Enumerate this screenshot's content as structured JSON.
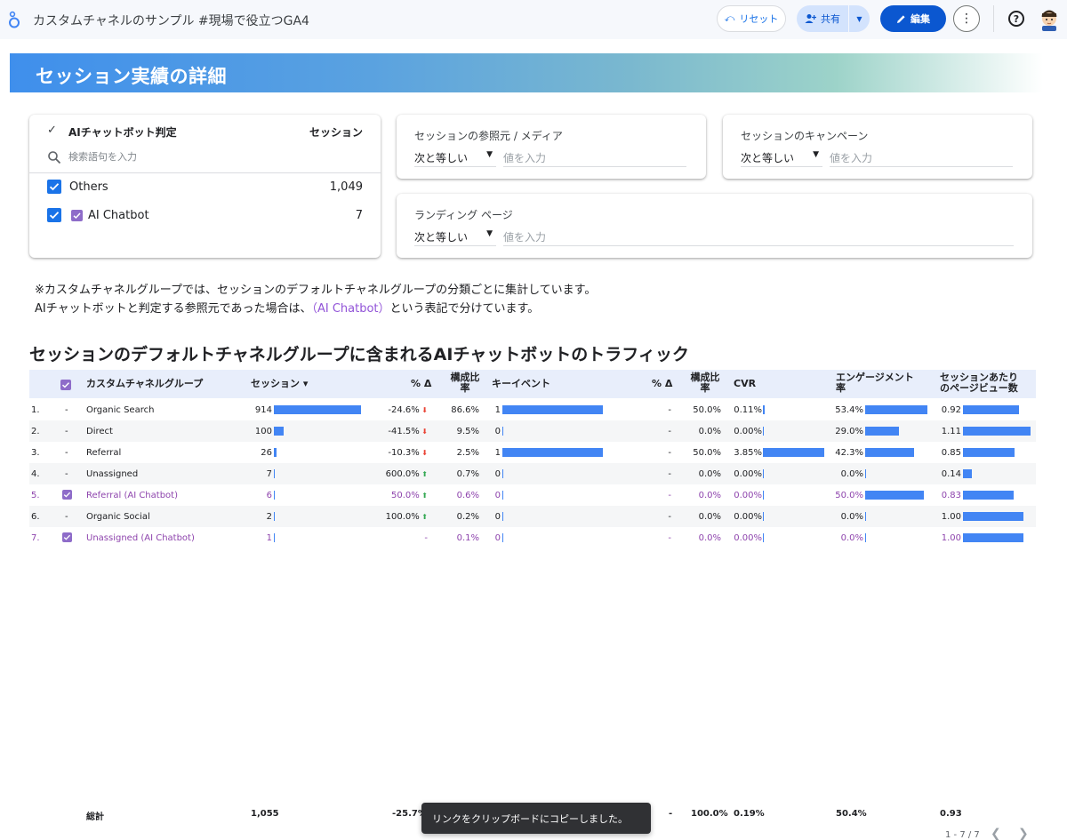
{
  "header": {
    "title": "カスタムチャネルのサンプル #現場で役立つGA4",
    "reset_label": "リセット",
    "share_label": "共有",
    "edit_label": "編集"
  },
  "banner": {
    "title": "セッション実績の詳細"
  },
  "ai_filter": {
    "dimension_label": "AIチャットボット判定",
    "metric_label": "セッション",
    "search_placeholder": "検索語句を入力",
    "items": [
      {
        "label": "Others",
        "value": "1,049"
      },
      {
        "label": "AI Chatbot",
        "value": "7"
      }
    ]
  },
  "filters": {
    "source_medium": {
      "title": "セッションの参照元 / メディア",
      "operator": "次と等しい",
      "placeholder": "値を入力"
    },
    "campaign": {
      "title": "セッションのキャンペーン",
      "operator": "次と等しい",
      "placeholder": "値を入力"
    },
    "landing_page": {
      "title": "ランディング ページ",
      "operator": "次と等しい",
      "placeholder": "値を入力"
    }
  },
  "notes": {
    "line1": "※カスタムチャネルグループでは、セッションのデフォルトチャネルグループの分類ごとに集計しています。",
    "line2_pre": "AIチャットボットと判定する参照元であった場合は、",
    "line2_accent": "（AI Chatbot）",
    "line2_post": "という表記で分けています。"
  },
  "table": {
    "title": "セッションのデフォルトチャネルグループに含まれるAIチャットボットのトラフィック",
    "headers": {
      "channel": "カスタムチャネルグループ",
      "sessions": "セッション ▾",
      "delta1": "% Δ",
      "share1_l1": "構成比",
      "share1_l2": "率",
      "key_events": "キーイベント",
      "delta2": "% Δ",
      "share2_l1": "構成比",
      "share2_l2": "率",
      "cvr": "CVR",
      "engagement_l1": "エンゲージメント",
      "engagement_l2": "率",
      "pv_l1": "セッションあたり",
      "pv_l2": "のページビュー数"
    },
    "rows": [
      {
        "index": "1.",
        "ai": "-",
        "channel": "Organic Search",
        "sessions": "914",
        "sessions_n": 914,
        "delta": "-24.6%",
        "dir": "down",
        "share": "86.6%",
        "key_events": "1",
        "key_events_n": 1,
        "delta2": "-",
        "share2": "50.0%",
        "cvr": "0.11%",
        "cvr_n": 0.11,
        "engagement": "53.4%",
        "engagement_n": 53.4,
        "pv": "0.92",
        "pv_n": 0.92
      },
      {
        "index": "2.",
        "ai": "-",
        "channel": "Direct",
        "sessions": "100",
        "sessions_n": 100,
        "delta": "-41.5%",
        "dir": "down",
        "share": "9.5%",
        "key_events": "0",
        "key_events_n": 0,
        "delta2": "-",
        "share2": "0.0%",
        "cvr": "0.00%",
        "cvr_n": 0,
        "engagement": "29.0%",
        "engagement_n": 29.0,
        "pv": "1.11",
        "pv_n": 1.11
      },
      {
        "index": "3.",
        "ai": "-",
        "channel": "Referral",
        "sessions": "26",
        "sessions_n": 26,
        "delta": "-10.3%",
        "dir": "down",
        "share": "2.5%",
        "key_events": "1",
        "key_events_n": 1,
        "delta2": "-",
        "share2": "50.0%",
        "cvr": "3.85%",
        "cvr_n": 3.85,
        "engagement": "42.3%",
        "engagement_n": 42.3,
        "pv": "0.85",
        "pv_n": 0.85
      },
      {
        "index": "4.",
        "ai": "-",
        "channel": "Unassigned",
        "sessions": "7",
        "sessions_n": 7,
        "delta": "600.0%",
        "dir": "up",
        "share": "0.7%",
        "key_events": "0",
        "key_events_n": 0,
        "delta2": "-",
        "share2": "0.0%",
        "cvr": "0.00%",
        "cvr_n": 0,
        "engagement": "0.0%",
        "engagement_n": 0,
        "pv": "0.14",
        "pv_n": 0.14
      },
      {
        "index": "5.",
        "ai": "check",
        "channel": "Referral (AI Chatbot)",
        "sessions": "6",
        "sessions_n": 6,
        "delta": "50.0%",
        "dir": "up",
        "share": "0.6%",
        "key_events": "0",
        "key_events_n": 0,
        "delta2": "-",
        "share2": "0.0%",
        "cvr": "0.00%",
        "cvr_n": 0,
        "engagement": "50.0%",
        "engagement_n": 50.0,
        "pv": "0.83",
        "pv_n": 0.83
      },
      {
        "index": "6.",
        "ai": "-",
        "channel": "Organic Social",
        "sessions": "2",
        "sessions_n": 2,
        "delta": "100.0%",
        "dir": "up",
        "share": "0.2%",
        "key_events": "0",
        "key_events_n": 0,
        "delta2": "-",
        "share2": "0.0%",
        "cvr": "0.00%",
        "cvr_n": 0,
        "engagement": "0.0%",
        "engagement_n": 0,
        "pv": "1.00",
        "pv_n": 1.0
      },
      {
        "index": "7.",
        "ai": "check",
        "channel": "Unassigned (AI Chatbot)",
        "sessions": "1",
        "sessions_n": 1,
        "delta": "-",
        "dir": "none",
        "share": "0.1%",
        "key_events": "0",
        "key_events_n": 0,
        "delta2": "-",
        "share2": "0.0%",
        "cvr": "0.00%",
        "cvr_n": 0,
        "engagement": "0.0%",
        "engagement_n": 0,
        "pv": "1.00",
        "pv_n": 1.0
      }
    ],
    "totals": {
      "label": "総計",
      "sessions": "1,055",
      "delta": "-25.7%",
      "delta2": "-",
      "share2": "100.0%",
      "cvr": "0.19%",
      "engagement": "50.4%",
      "pv": "0.93"
    },
    "pager": "1 - 7 / 7"
  },
  "toast": {
    "message": "リンクをクリップボードにコピーしました。"
  },
  "colors": {
    "bar": "#4285f4",
    "ai_accent": "#8e44ad",
    "primary": "#0b57d0"
  }
}
